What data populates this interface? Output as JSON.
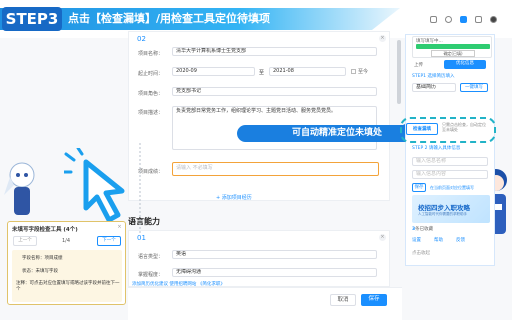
{
  "header": {
    "step_label": "STEP3",
    "title": "点击【检查漏填】/用检查工具定位待填项"
  },
  "form_top": {
    "section_num": "02",
    "fields": [
      {
        "label": "项目名称：",
        "value": "清华大学计算机系博士生党支部"
      },
      {
        "label": "起止时间：",
        "start": "2020-09",
        "separator": "至",
        "end": "2021-08",
        "checkbox_label": "至今"
      },
      {
        "label": "项目角色：",
        "value": "党支部书记"
      },
      {
        "label": "项目描述：",
        "value": "负责党部日常党务工作，组织理论学习、主题党日活动、服务党员党员。"
      },
      {
        "label": "项目成绩：",
        "placeholder": "请输入 不必填写"
      }
    ],
    "add_link": "添加项目经历"
  },
  "callout": "可自动精准定位未填处",
  "language_section": {
    "title": "语言能力",
    "section_num": "01",
    "fields": [
      {
        "label": "语言类型：",
        "value": "英语"
      },
      {
        "label": "掌握程度：",
        "value": "无障碍沟通"
      }
    ],
    "ext_note": "添加简历优化建议 使用招聘网站 《简化求职》"
  },
  "popup": {
    "title": "未填写字段检查工具 (4个)",
    "prev": "上一个",
    "counter": "1/4",
    "next": "下一个",
    "field_name_label": "字段名称：",
    "field_name_value": "项目成绩",
    "status_label": "状态：",
    "status_value": "未填写字段",
    "tip_label": "注释：",
    "tip_value": "可点击对应位置填写或略过该字段并前往下一个"
  },
  "ext_panel": {
    "mini_title": "填写填写中...",
    "mini_btn": "确定(已填)",
    "tabs": [
      "上传",
      "优化信息"
    ],
    "step1": "STEP1 选择简历填入",
    "dropdown": "基础简历",
    "fill_btn": "一键填写",
    "check_btn": "检查漏填",
    "check_hint": "只需点击检查，自动定位至未填处",
    "step2": "STEP 2 请输入具体信息",
    "input1_placeholder": "输入信息名称",
    "input2_placeholder": "输入信息内容",
    "save_btn": "保存",
    "save_hint": "在当前页面对应位置填写",
    "banner_text": "校招四步入职攻略",
    "banner_sub": "人工智能时代你需要的求职助手",
    "count_text": "条已收藏",
    "count_num": "3",
    "links": [
      "设置",
      "帮助",
      "反馈"
    ],
    "bottom_text": "点击收起"
  },
  "footer": {
    "cancel": "取消",
    "save": "保存"
  },
  "colors": {
    "brand_blue": "#1a8fff",
    "step_dark": "#1769c5",
    "highlight_orange": "#f3a33a",
    "popup_border": "#e0c36a",
    "teal_dash": "#22b3c7"
  }
}
